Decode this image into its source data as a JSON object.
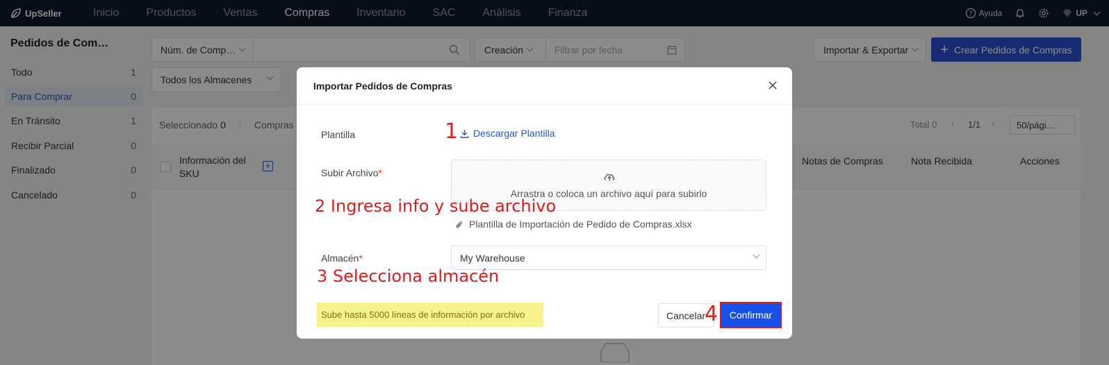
{
  "app": {
    "logo": "UpSeller"
  },
  "nav": [
    "Inicio",
    "Productos",
    "Ventas",
    "Compras",
    "Inventario",
    "SAC",
    "Análisis",
    "Finanza"
  ],
  "nav_active": "Compras",
  "topbar": {
    "help": "Ayuda",
    "user": "UP"
  },
  "sidebar": {
    "title": "Pedidos de Com…",
    "items": [
      {
        "label": "Todo",
        "count": "1"
      },
      {
        "label": "Para Comprar",
        "count": "0"
      },
      {
        "label": "En Tránsito",
        "count": "1"
      },
      {
        "label": "Recibir Parcial",
        "count": "0"
      },
      {
        "label": "Finalizado",
        "count": "0"
      },
      {
        "label": "Cancelado",
        "count": "0"
      }
    ]
  },
  "filters": {
    "search_type": "Núm. de Comp…",
    "date_type": "Creación",
    "date_placeholder": "Filtrar por fecha",
    "warehouse": "Todos los Almacenes",
    "import_export": "Importar & Exportar",
    "create": "Crear Pedidos de Compras"
  },
  "list": {
    "selected_label": "Seleccionado",
    "selected_count": "0",
    "compras": "Compras",
    "total": "Total 0",
    "page": "1/1",
    "page_size": "50/pági…",
    "columns": {
      "sku": "Información del SKU",
      "notes": "Notas de Compras",
      "received": "Nota Recibida",
      "actions": "Acciones"
    }
  },
  "modal": {
    "title": "Importar Pedidos de Compras",
    "template_label": "Plantilla",
    "download_link": "Descargar Plantilla",
    "upload_label": "Subir Archivo",
    "upload_hint": "Arrastra o coloca un archivo aquí para subirlo",
    "file_name": "Plantilla de Importación de Pedido de Compras.xlsx",
    "warehouse_label": "Almacén",
    "warehouse_value": "My Warehouse",
    "note": "Sube hasta 5000 líneas de información por archivo",
    "cancel": "Cancelar",
    "confirm": "Confirmar"
  },
  "annotations": {
    "step1": "1",
    "step2": "2 Ingresa info y sube archivo",
    "step3": "3 Selecciona almacén",
    "step4": "4"
  },
  "colors": {
    "primary": "#2b4fcf",
    "topbar": "#0d1b2e",
    "annotation": "#e01b1b",
    "note_bg": "#f8f28c"
  }
}
